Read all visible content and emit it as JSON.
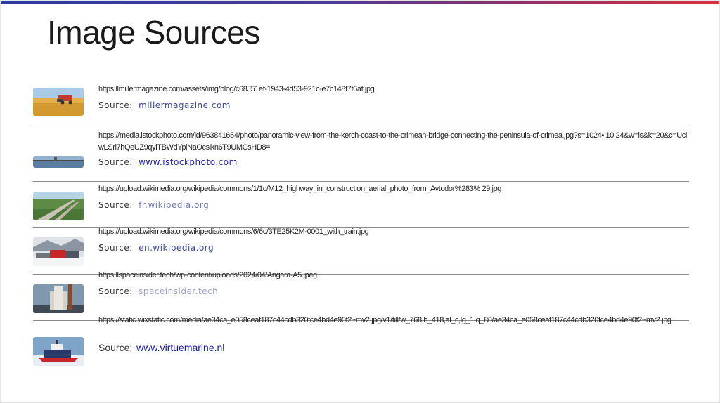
{
  "page": {
    "title": "Image Sources"
  },
  "entries": [
    {
      "url": "https:llmillermagazine.com/assets/img/blog/c68J51ef-1943-4d53-921c-e7c148f7f6af.jpg",
      "source_label": "Source:",
      "source_link": "millermagazine.com",
      "link_color": "#3a4a9f",
      "thumb_icon": "wheat-field-harvester"
    },
    {
      "url": "https://media.istockphoto.com/id/963841654/photo/panoramic-view-from-the-kerch-coast-to-the-crimean-bridge-connecting-the-peninsula-of-crimea.jpg?s=1024• 10 24&w=is&k=20&c=UciwLSrl7hQeUZ9qylTBWdYpiNaOcsikn6T9UMCsHD8=",
      "source_label": "Source:",
      "source_link": "www.istockphoto.com",
      "link_color": "#1a1aa6",
      "thumb_icon": "bridge-panorama"
    },
    {
      "url": "https://upload.wikimedia.org/wikipedia/commons/1/1c/M12_highway_in_construction_aerial_photo_from_Avtodor%283% 29.jpg",
      "source_label": "Source:",
      "source_link": "fr.wikipedia.org",
      "link_color": "#6f7ab8",
      "thumb_icon": "aerial-highway"
    },
    {
      "url": "https://upload.wikimedia.org/wikipedia/commons/6/6c/3TE25K2M-0001_with_train.jpg",
      "source_label": "Source:",
      "source_link": "en.wikipedia.org",
      "link_color": "#3a4a9f",
      "thumb_icon": "snowy-train"
    },
    {
      "url": "https:llspaceinsider.tech/wp-content/uploads/2024/04/Angara-A5.jpeg",
      "source_label": "Source:",
      "source_link": "spaceinsider.tech",
      "link_color": "#9aa0d0",
      "thumb_icon": "rocket-launchpad"
    },
    {
      "url": "https://static.wixstatic.com/media/ae34ca_e058ceaf187c44cdb320fce4bd4e90f2~mv2.jpg/v1/fill/w_768,h_418,al_c,lg_1,q_80/ae34ca_e058ceaf187c44cdb320fce4bd4e90f2~mv2.jpg",
      "source_label": "Source:",
      "source_link": "www.virtuemarine.nl",
      "link_color": "#1a1aa6",
      "thumb_icon": "icebreaker-ship"
    }
  ]
}
